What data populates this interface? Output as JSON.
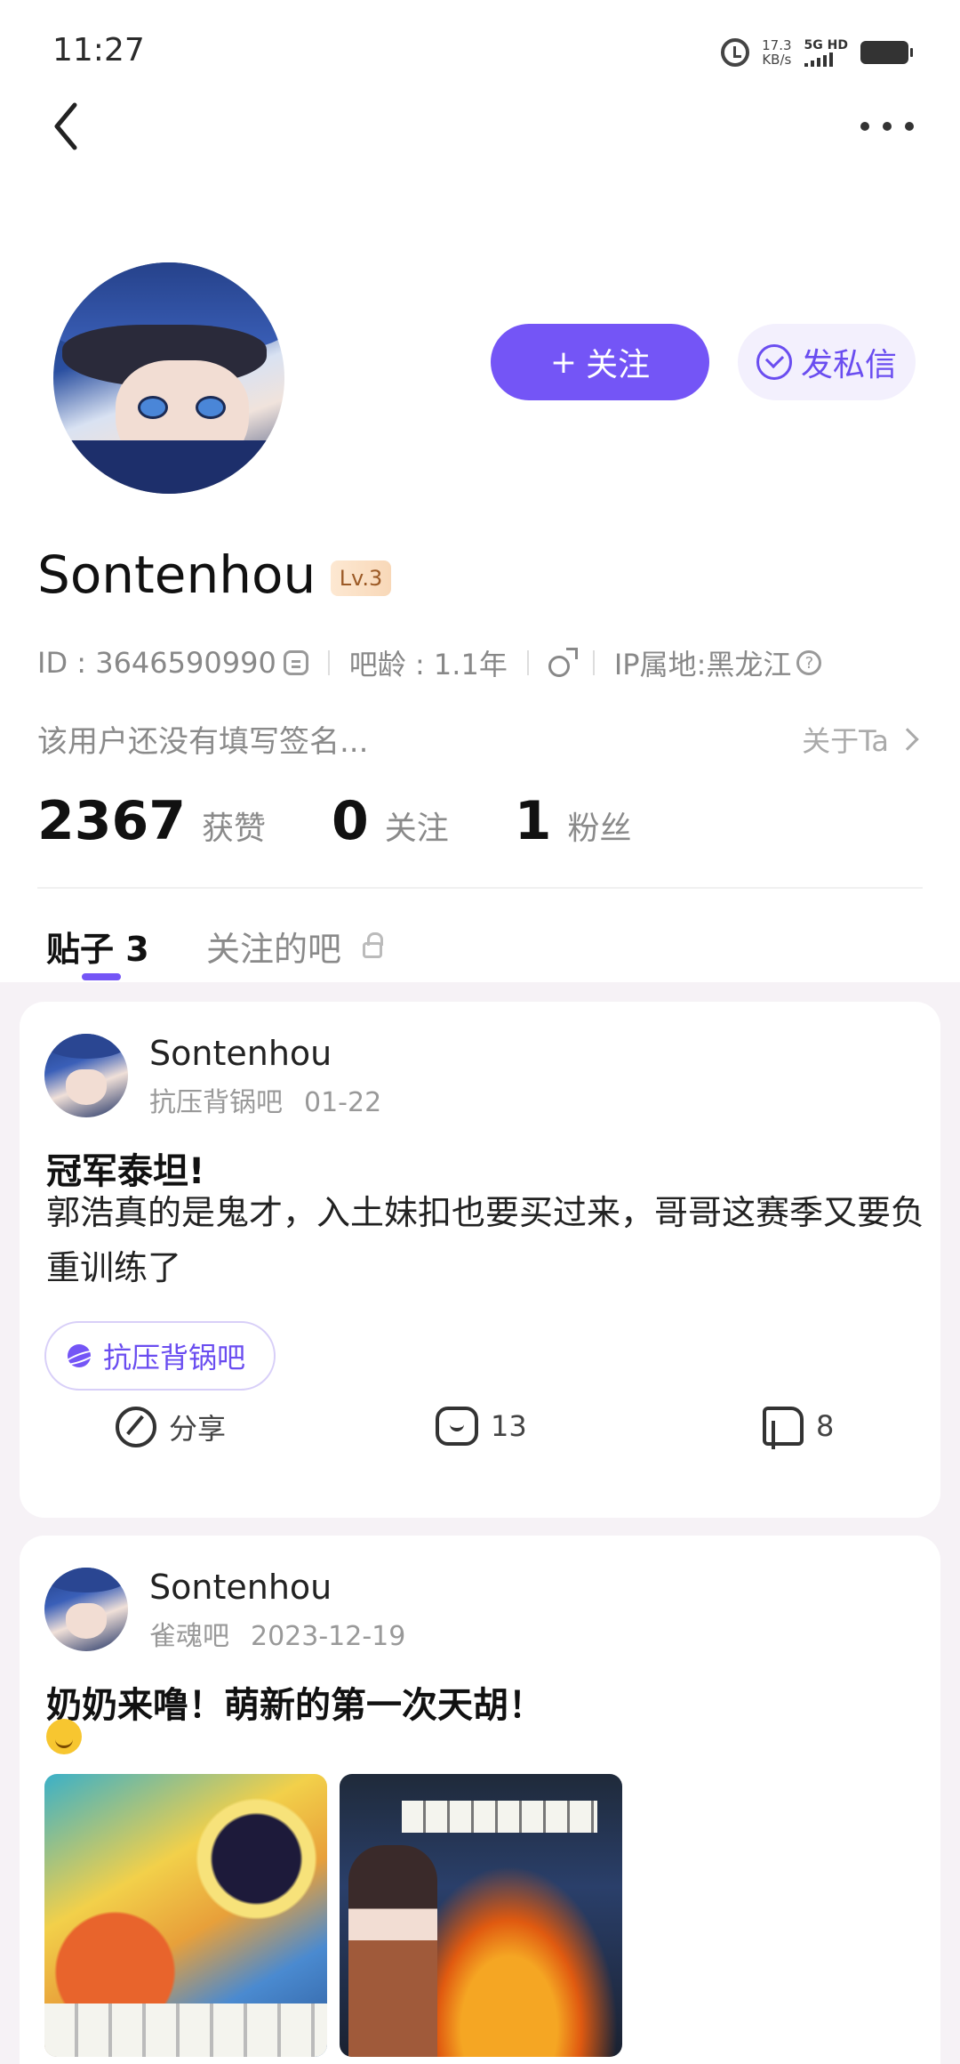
{
  "status_bar": {
    "time": "11:27",
    "net_speed_value": "17.3",
    "net_speed_unit": "KB/s",
    "network": "5G HD"
  },
  "profile": {
    "username": "Sontenhou",
    "level": "Lv.3",
    "id_text": "ID : 3646590990",
    "forum_age": "吧龄 : 1.1年",
    "ip_location": "IP属地:黑龙江",
    "signature": "该用户还没有填写签名...",
    "about_link": "关于Ta",
    "follow_button": "关注",
    "follow_plus": "+",
    "message_button": "发私信"
  },
  "stats": [
    {
      "value": "2367",
      "label": "获赞"
    },
    {
      "value": "0",
      "label": "关注"
    },
    {
      "value": "1",
      "label": "粉丝"
    }
  ],
  "tabs": {
    "posts": "贴子 3",
    "followed_forums": "关注的吧"
  },
  "posts": [
    {
      "author": "Sontenhou",
      "forum": "抗压背锅吧",
      "date": "01-22",
      "title": "冠军泰坦!",
      "body": "郭浩真的是鬼才，入土妹扣也要买过来，哥哥这赛季又要负重训练了",
      "tag": "抗压背锅吧",
      "share_label": "分享",
      "comments": "13",
      "likes": "8"
    },
    {
      "author": "Sontenhou",
      "forum": "雀魂吧",
      "date": "2023-12-19",
      "title": "奶奶来噜！萌新的第一次天胡！"
    }
  ],
  "colors": {
    "accent": "#7455f6",
    "accent_light": "#f3f0fd",
    "feed_background": "#f6f2f6"
  }
}
